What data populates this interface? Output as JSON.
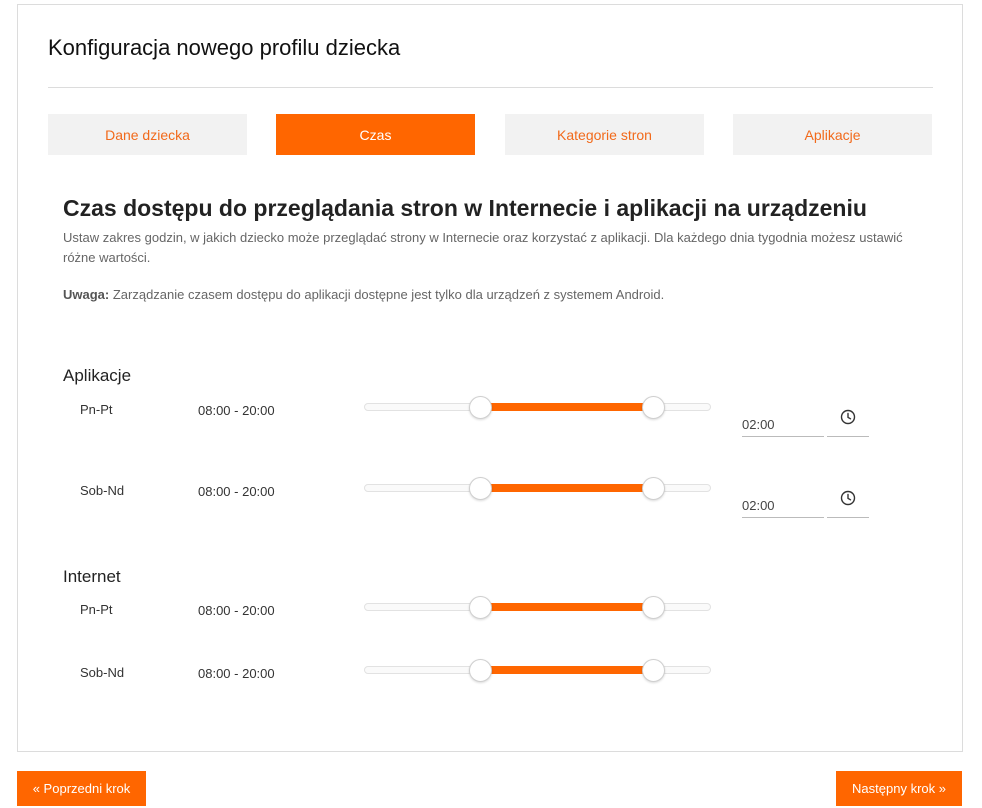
{
  "header": {
    "title": "Konfiguracja nowego profilu dziecka"
  },
  "tabs": [
    {
      "label": "Dane dziecka",
      "active": false
    },
    {
      "label": "Czas",
      "active": true
    },
    {
      "label": "Kategorie stron",
      "active": false
    },
    {
      "label": "Aplikacje",
      "active": false
    }
  ],
  "section": {
    "heading": "Czas dostępu do przeglądania stron w Internecie i aplikacji na urządzeniu",
    "description": "Ustaw zakres godzin, w jakich dziecko może przeglądać strony w Internecie oraz korzystać z aplikacji. Dla każdego dnia tygodnia możesz ustawić różne wartości.",
    "note_label": "Uwaga:",
    "note_text": " Zarządzanie czasem dostępu do aplikacji dostępne jest tylko dla urządzeń z systemem Android."
  },
  "apps": {
    "title": "Aplikacje",
    "rows": [
      {
        "day": "Pn-Pt",
        "range": "08:00 - 20:00",
        "limit": "02:00",
        "start_fraction": 0.333,
        "end_fraction": 0.833
      },
      {
        "day": "Sob-Nd",
        "range": "08:00 - 20:00",
        "limit": "02:00",
        "start_fraction": 0.333,
        "end_fraction": 0.833
      }
    ]
  },
  "internet": {
    "title": "Internet",
    "rows": [
      {
        "day": "Pn-Pt",
        "range": "08:00 - 20:00",
        "start_fraction": 0.333,
        "end_fraction": 0.833
      },
      {
        "day": "Sob-Nd",
        "range": "08:00 - 20:00",
        "start_fraction": 0.333,
        "end_fraction": 0.833
      }
    ]
  },
  "icons": {
    "time_picker": "clock-icon"
  },
  "colors": {
    "accent": "#ff6600",
    "tab_inactive_bg": "#f2f2f2",
    "tab_inactive_text": "#f26a1b"
  },
  "footer": {
    "prev_label": "« Poprzedni krok",
    "next_label": "Następny krok »"
  }
}
